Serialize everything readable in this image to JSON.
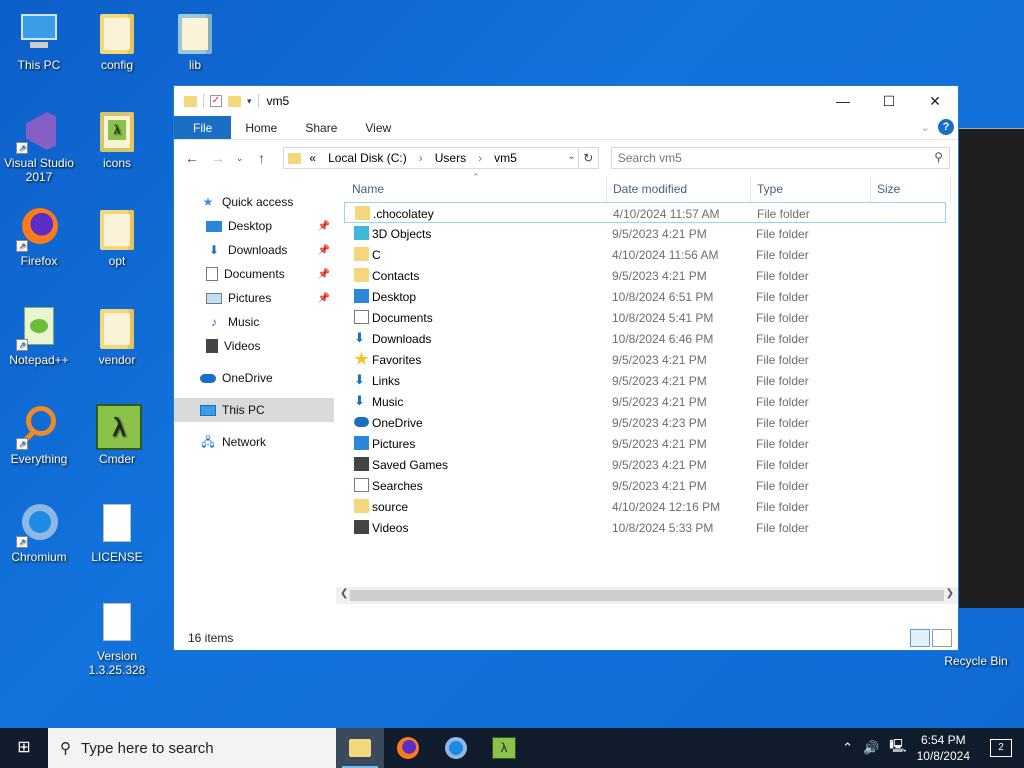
{
  "desktop": {
    "icons": [
      {
        "label": "This PC"
      },
      {
        "label": "config"
      },
      {
        "label": "lib"
      },
      {
        "label": "Visual Studio 2017"
      },
      {
        "label": "icons"
      },
      {
        "label": "Firefox"
      },
      {
        "label": "opt"
      },
      {
        "label": "Notepad++"
      },
      {
        "label": "vendor"
      },
      {
        "label": "Everything"
      },
      {
        "label": "Cmder"
      },
      {
        "label": "Chromium"
      },
      {
        "label": "LICENSE"
      },
      {
        "label": "Version 1.3.25.328"
      },
      {
        "label": "Recycle Bin"
      }
    ]
  },
  "explorer": {
    "title": "vm5",
    "window_buttons": {
      "minimize": "—",
      "maximize": "☐",
      "close": "✕"
    },
    "ribbon": {
      "tabs": [
        "File",
        "Home",
        "Share",
        "View"
      ]
    },
    "address": {
      "segments": [
        "«",
        "Local Disk (C:)",
        "›",
        "Users",
        "›",
        "vm5"
      ]
    },
    "search": {
      "placeholder": "Search vm5"
    },
    "nav": {
      "items": [
        {
          "label": "Quick access",
          "icon": "star-icon"
        },
        {
          "label": "Desktop",
          "icon": "desktop-icon",
          "pinned": true
        },
        {
          "label": "Downloads",
          "icon": "download-icon",
          "pinned": true
        },
        {
          "label": "Documents",
          "icon": "document-icon",
          "pinned": true
        },
        {
          "label": "Pictures",
          "icon": "pictures-icon",
          "pinned": true
        },
        {
          "label": "Music",
          "icon": "music-icon"
        },
        {
          "label": "Videos",
          "icon": "videos-icon"
        },
        {
          "label": "OneDrive",
          "icon": "cloud-icon"
        },
        {
          "label": "This PC",
          "icon": "computer-icon",
          "selected": true
        },
        {
          "label": "Network",
          "icon": "network-icon"
        }
      ]
    },
    "columns": {
      "name": "Name",
      "date": "Date modified",
      "type": "Type",
      "size": "Size"
    },
    "files": [
      {
        "name": ".chocolatey",
        "date": "4/10/2024 11:57 AM",
        "type": "File folder",
        "icon": "folder"
      },
      {
        "name": "3D Objects",
        "date": "9/5/2023 4:21 PM",
        "type": "File folder",
        "icon": "cyan"
      },
      {
        "name": "C",
        "date": "4/10/2024 11:56 AM",
        "type": "File folder",
        "icon": "folder"
      },
      {
        "name": "Contacts",
        "date": "9/5/2023 4:21 PM",
        "type": "File folder",
        "icon": "folder"
      },
      {
        "name": "Desktop",
        "date": "10/8/2024 6:51 PM",
        "type": "File folder",
        "icon": "blue"
      },
      {
        "name": "Documents",
        "date": "10/8/2024 5:41 PM",
        "type": "File folder",
        "icon": "doc"
      },
      {
        "name": "Downloads",
        "date": "10/8/2024 6:46 PM",
        "type": "File folder",
        "icon": "arrow"
      },
      {
        "name": "Favorites",
        "date": "9/5/2023 4:21 PM",
        "type": "File folder",
        "icon": "gold"
      },
      {
        "name": "Links",
        "date": "9/5/2023 4:21 PM",
        "type": "File folder",
        "icon": "arrow"
      },
      {
        "name": "Music",
        "date": "9/5/2023 4:21 PM",
        "type": "File folder",
        "icon": "arrow"
      },
      {
        "name": "OneDrive",
        "date": "9/5/2023 4:23 PM",
        "type": "File folder",
        "icon": "cloud"
      },
      {
        "name": "Pictures",
        "date": "9/5/2023 4:21 PM",
        "type": "File folder",
        "icon": "blue"
      },
      {
        "name": "Saved Games",
        "date": "9/5/2023 4:21 PM",
        "type": "File folder",
        "icon": "dark"
      },
      {
        "name": "Searches",
        "date": "9/5/2023 4:21 PM",
        "type": "File folder",
        "icon": "doc"
      },
      {
        "name": "source",
        "date": "4/10/2024 12:16 PM",
        "type": "File folder",
        "icon": "folder"
      },
      {
        "name": "Videos",
        "date": "10/8/2024 5:33 PM",
        "type": "File folder",
        "icon": "dark"
      }
    ],
    "status": {
      "count": "16 items"
    }
  },
  "taskbar": {
    "search_placeholder": "Type here to search",
    "time": "6:54 PM",
    "date": "10/8/2024",
    "notifications": "2"
  }
}
